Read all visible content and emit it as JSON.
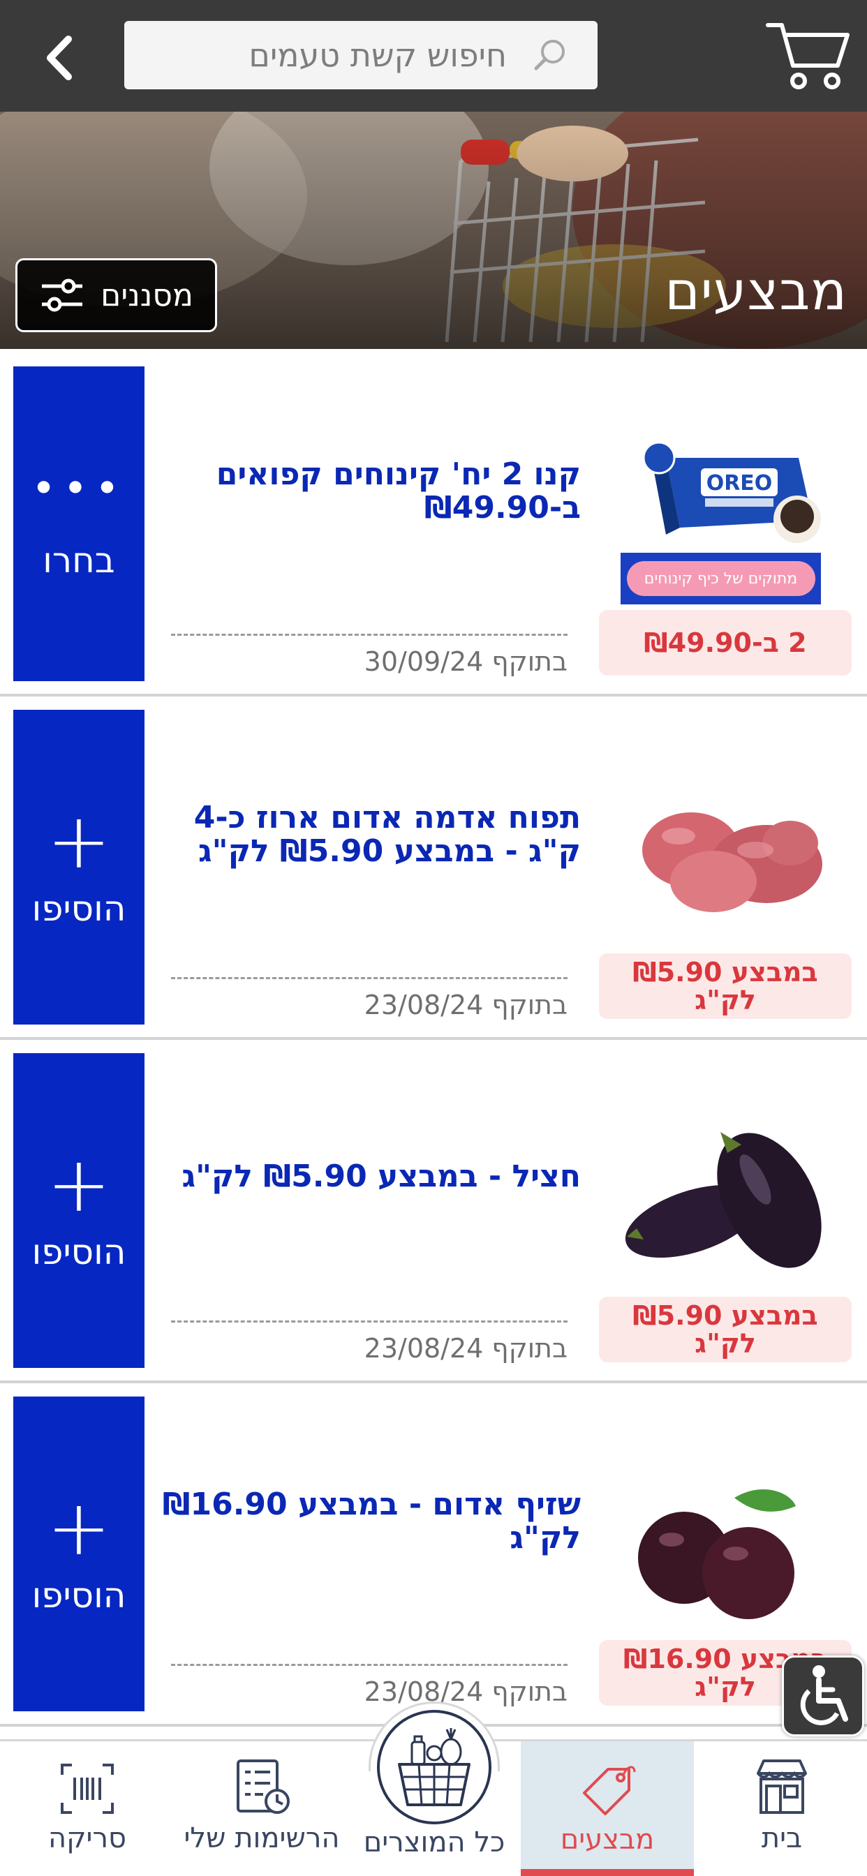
{
  "search": {
    "placeholder": "חיפוש קשת טעמים"
  },
  "hero": {
    "title": "מבצעים",
    "filters_label": "מסננים"
  },
  "offers": [
    {
      "title": "קנו 2 יח' קינוחים קפואים ב-₪49.90",
      "price": "2 ב-₪49.90",
      "valid": "בתוקף 30/09/24",
      "cta": "בחרו",
      "cta_symbol": "•••",
      "image": "oreo-cheesecake",
      "badge_text": "מתוקים של כיף קינוחים"
    },
    {
      "title": "תפוח אדמה אדום ארוז כ-4 ק\"ג - במבצע ₪5.90 לק\"ג",
      "price": "במבצע ₪5.90 לק\"ג",
      "valid": "בתוקף 23/08/24",
      "cta": "הוסיפו",
      "cta_symbol": "+",
      "image": "red-potatoes"
    },
    {
      "title": "חציל - במבצע ₪5.90 לק\"ג",
      "price": "במבצע ₪5.90 לק\"ג",
      "valid": "בתוקף 23/08/24",
      "cta": "הוסיפו",
      "cta_symbol": "+",
      "image": "eggplants"
    },
    {
      "title": "שזיף אדום - במבצע ₪16.90 לק\"ג",
      "price": "במבצע ₪16.90 לק\"ג",
      "valid": "בתוקף 23/08/24",
      "cta": "הוסיפו",
      "cta_symbol": "+",
      "image": "red-plums"
    }
  ],
  "nav": {
    "home": "בית",
    "deals": "מבצעים",
    "all_products": "כל המוצרים",
    "my_lists": "הרשימות שלי",
    "scan": "סריקה"
  },
  "colors": {
    "cta_blue": "#0727c2",
    "title_blue": "#0a28b4",
    "price_red": "#d8383d",
    "price_bg": "#fde8e8",
    "topbar": "#3a3a3a",
    "nav_active": "#e14a4f"
  }
}
